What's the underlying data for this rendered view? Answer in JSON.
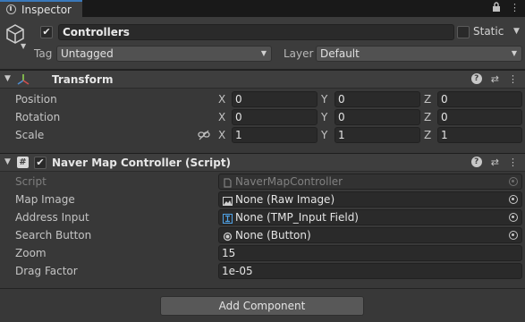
{
  "tab": {
    "label": "Inspector",
    "icon": "info-icon"
  },
  "window_tools": {
    "lock": "lock-icon",
    "menu": "kebab-menu-icon"
  },
  "gameobject": {
    "name": "Controllers",
    "active": true,
    "static_label": "Static",
    "static": false,
    "tag_label": "Tag",
    "tag_value": "Untagged",
    "layer_label": "Layer",
    "layer_value": "Default"
  },
  "transform": {
    "title": "Transform",
    "rows": [
      {
        "label": "Position",
        "x": "0",
        "y": "0",
        "z": "0"
      },
      {
        "label": "Rotation",
        "x": "0",
        "y": "0",
        "z": "0"
      },
      {
        "label": "Scale",
        "x": "1",
        "y": "1",
        "z": "1"
      }
    ],
    "axes": {
      "x": "X",
      "y": "Y",
      "z": "Z"
    }
  },
  "script_component": {
    "title": "Naver Map Controller (Script)",
    "enabled": true,
    "fields": {
      "script": {
        "label": "Script",
        "value": "NaverMapController"
      },
      "map_image": {
        "label": "Map Image",
        "value": "None (Raw Image)"
      },
      "address_input": {
        "label": "Address Input",
        "value": "None (TMP_Input Field)"
      },
      "search_button": {
        "label": "Search Button",
        "value": "None (Button)"
      },
      "zoom": {
        "label": "Zoom",
        "value": "15"
      },
      "drag_factor": {
        "label": "Drag Factor",
        "value": "1e-05"
      }
    }
  },
  "add_component_label": "Add Component",
  "colors": {
    "background": "#383838",
    "tab_accent": "#3a79bb",
    "field_bg": "#2a2a2a"
  }
}
